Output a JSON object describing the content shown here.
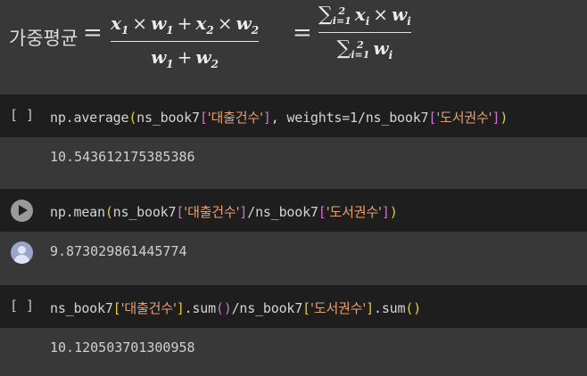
{
  "formula": {
    "label": "가중평균",
    "equals": "="
  },
  "cells": [
    {
      "run_label": "[ ]",
      "code": {
        "fn": "np.average",
        "arg1_var": "ns_book7",
        "arg1_key": "'대출건수'",
        "mid": ", weights=1/ns_book7",
        "arg2_key": "'도서권수'"
      },
      "output": "10.543612175385386"
    },
    {
      "run_label": "",
      "code": {
        "fn": "np.mean",
        "arg1_var": "ns_book7",
        "arg1_key": "'대출건수'",
        "mid": "/ns_book7",
        "arg2_key": "'도서권수'"
      },
      "output": "9.873029861445774"
    },
    {
      "run_label": "[ ]",
      "code": {
        "var1": "ns_book7",
        "key1": "'대출건수'",
        "sum1": ".sum",
        "mid": "/ns_book7",
        "key2": "'도서권수'",
        "sum2": ".sum"
      },
      "output": "10.120503701300958"
    }
  ]
}
